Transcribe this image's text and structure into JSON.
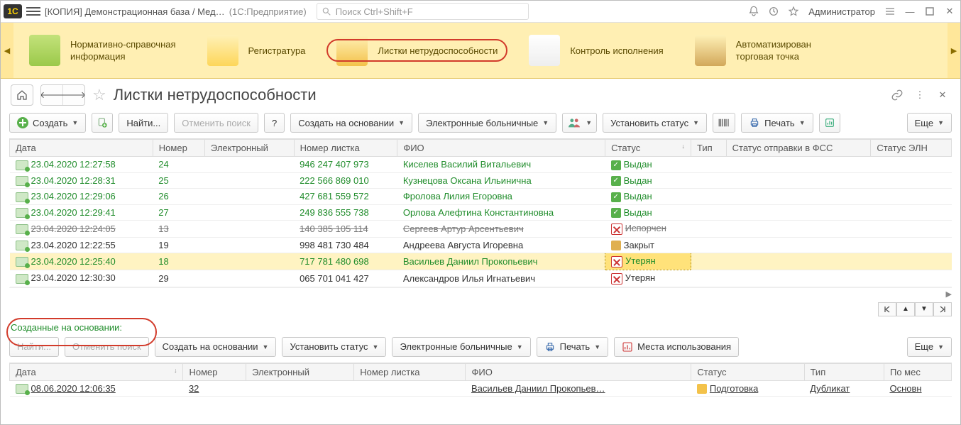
{
  "titlebar": {
    "app_label": "1С",
    "title": "[КОПИЯ] Демонстрационная база / Мед…",
    "suffix": "(1С:Предприятие)",
    "search_placeholder": "Поиск Ctrl+Shift+F",
    "user": "Администратор"
  },
  "sections": [
    {
      "label_line1": "Нормативно-справочная",
      "label_line2": "информация",
      "icon": "books",
      "selected": false
    },
    {
      "label_line1": "Регистратура",
      "label_line2": "",
      "icon": "reg",
      "selected": false
    },
    {
      "label_line1": "Листки нетрудоспособности",
      "label_line2": "",
      "icon": "sheets",
      "selected": true
    },
    {
      "label_line1": "Контроль исполнения",
      "label_line2": "",
      "icon": "ctrl",
      "selected": false
    },
    {
      "label_line1": "Автоматизирован",
      "label_line2": "торговая точка",
      "icon": "atm",
      "selected": false
    }
  ],
  "page": {
    "title": "Листки нетрудоспособности"
  },
  "toolbar": {
    "create": "Создать",
    "find": "Найти...",
    "cancel_search": "Отменить поиск",
    "create_based": "Создать на основании",
    "eln": "Электронные больничные",
    "set_status": "Установить статус",
    "print": "Печать",
    "more": "Еще"
  },
  "columns": [
    "Дата",
    "Номер",
    "Электронный",
    "Номер листка",
    "ФИО",
    "Статус",
    "Тип",
    "Статус отправки в ФСС",
    "Статус ЭЛН"
  ],
  "rows": [
    {
      "date": "23.04.2020 12:27:58",
      "num": "24",
      "eln": "",
      "sheet": "946 247 407 973",
      "fio": "Киселев Василий Витальевич",
      "status": "Выдан",
      "st": "ok",
      "cls": "green"
    },
    {
      "date": "23.04.2020 12:28:31",
      "num": "25",
      "eln": "",
      "sheet": "222 566 869 010",
      "fio": "Кузнецова Оксана Ильинична",
      "status": "Выдан",
      "st": "ok",
      "cls": "green"
    },
    {
      "date": "23.04.2020 12:29:06",
      "num": "26",
      "eln": "",
      "sheet": "427 681 559 572",
      "fio": "Фролова Лилия Егоровна",
      "status": "Выдан",
      "st": "ok",
      "cls": "green"
    },
    {
      "date": "23.04.2020 12:29:41",
      "num": "27",
      "eln": "",
      "sheet": "249 836 555 738",
      "fio": "Орлова Алефтина Константиновна",
      "status": "Выдан",
      "st": "ok",
      "cls": "green"
    },
    {
      "date": "23.04.2020 12:24:05",
      "num": "13",
      "eln": "",
      "sheet": "140 385 105 114",
      "fio": "Сергеев Артур Арсентьевич",
      "status": "Испорчен",
      "st": "x",
      "cls": "strike"
    },
    {
      "date": "23.04.2020 12:22:55",
      "num": "19",
      "eln": "",
      "sheet": "998 481 730 484",
      "fio": "Андреева Августа Игоревна",
      "status": "Закрыт",
      "st": "lock",
      "cls": ""
    },
    {
      "date": "23.04.2020 12:25:40",
      "num": "18",
      "eln": "",
      "sheet": "717 781 480 698",
      "fio": "Васильев Даниил Прокопьевич",
      "status": "Утерян",
      "st": "x",
      "cls": "sel green"
    },
    {
      "date": "23.04.2020 12:30:30",
      "num": "29",
      "eln": "",
      "sheet": "065 701 041 427",
      "fio": "Александров Илья Игнатьевич",
      "status": "Утерян",
      "st": "x",
      "cls": ""
    }
  ],
  "sub": {
    "title": "Созданные на основании:",
    "toolbar": {
      "find": "Найти...",
      "cancel": "Отменить поиск",
      "create_based": "Создать на основании",
      "set_status": "Установить статус",
      "eln": "Электронные больничные",
      "print": "Печать",
      "usage": "Места использования",
      "more": "Еще"
    },
    "columns": [
      "Дата",
      "Номер",
      "Электронный",
      "Номер листка",
      "ФИО",
      "Статус",
      "Тип",
      "По мес"
    ],
    "row": {
      "date": "08.06.2020 12:06:35",
      "num": "32",
      "eln": "",
      "sheet": "",
      "fio": "Васильев Даниил Прокопьев…",
      "status": "Подготовка",
      "type": "Дубликат",
      "place": "Основн"
    }
  }
}
